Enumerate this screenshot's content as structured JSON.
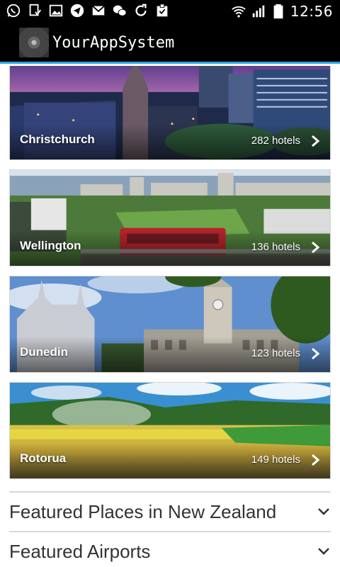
{
  "status_bar": {
    "time": "12:56",
    "icons": [
      "whatsapp-icon",
      "download-icon",
      "image-icon",
      "telegram-icon",
      "mail-icon",
      "wechat-icon",
      "sync-icon",
      "clipboard-icon",
      "wifi-icon",
      "signal-icon",
      "battery-icon"
    ]
  },
  "app": {
    "title": "YourAppSystem",
    "accent": "#2aa7e0"
  },
  "cities": [
    {
      "name": "Christchurch",
      "hotels": "282 hotels"
    },
    {
      "name": "Wellington",
      "hotels": "136 hotels"
    },
    {
      "name": "Dunedin",
      "hotels": "123 hotels"
    },
    {
      "name": "Rotorua",
      "hotels": "149 hotels"
    }
  ],
  "sections": [
    {
      "title": "Featured Places in New Zealand"
    },
    {
      "title": "Featured Airports"
    }
  ]
}
